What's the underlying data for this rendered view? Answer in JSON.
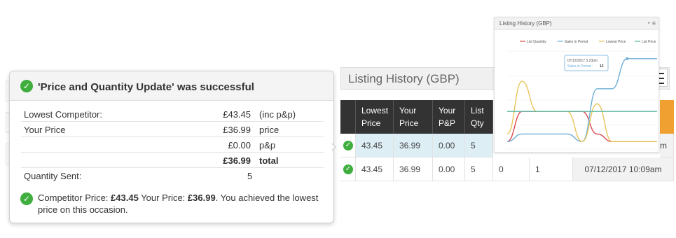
{
  "popup": {
    "title": "'Price and Quantity Update' was successful",
    "rows": [
      {
        "label": "Lowest Competitor:",
        "value": "£43.45",
        "unit": "(inc p&p)"
      },
      {
        "label": "Your Price",
        "value": "£36.99",
        "unit": "price"
      },
      {
        "label": "",
        "value": "£0.00",
        "unit": "p&p"
      },
      {
        "label": "",
        "value": "£36.99",
        "unit": "total"
      }
    ],
    "quantity_label": "Quantity Sent:",
    "quantity_value": "5",
    "footer": {
      "t1": "Competitor Price: ",
      "competitor_price": "£43.45",
      "t2": " Your Price: ",
      "your_price": "£36.99",
      "t3": ". You achieved the lowest price on this occasion."
    }
  },
  "listing_history": {
    "title": "Listing History (GBP)",
    "columns": [
      "Lowest Price",
      "Your Price",
      "Your P&P",
      "List Qty"
    ],
    "rows": [
      {
        "cells": [
          "43.45",
          "36.99",
          "0.00",
          "5"
        ],
        "date": "m"
      },
      {
        "cells": [
          "43.45",
          "36.99",
          "0.00",
          "5",
          "0",
          "1"
        ],
        "date": "07/12/2017 10:09am"
      }
    ]
  },
  "chart": {
    "title": "Listing History (GBP)",
    "legend": [
      "List Quantity",
      "Sales in Period",
      "Lowest Price",
      "List Price"
    ],
    "tooltip_time": "07/12/2017 3:23pm",
    "tooltip_label": "Sales in Period :",
    "tooltip_value": "12",
    "colors": {
      "list_quantity": "#d9474b",
      "sales_in_period": "#6aaed6",
      "lowest_price": "#e8c45a",
      "list_price": "#5bb5a2"
    }
  },
  "chart_data": {
    "type": "line",
    "title": "Listing History (GBP)",
    "series": [
      {
        "name": "List Quantity",
        "values": [
          1,
          5,
          5,
          5,
          5,
          5,
          2,
          1,
          1,
          1,
          1
        ]
      },
      {
        "name": "Sales in Period",
        "values": [
          1,
          2,
          2,
          2,
          2,
          1,
          8,
          8,
          12,
          12,
          12
        ]
      },
      {
        "name": "Lowest Price",
        "values": [
          2,
          9,
          5,
          5,
          5,
          1,
          6,
          1,
          1,
          1,
          1
        ]
      },
      {
        "name": "List Price",
        "values": [
          5,
          5,
          5,
          5,
          5,
          5,
          5,
          5,
          5,
          5,
          5
        ]
      }
    ]
  }
}
